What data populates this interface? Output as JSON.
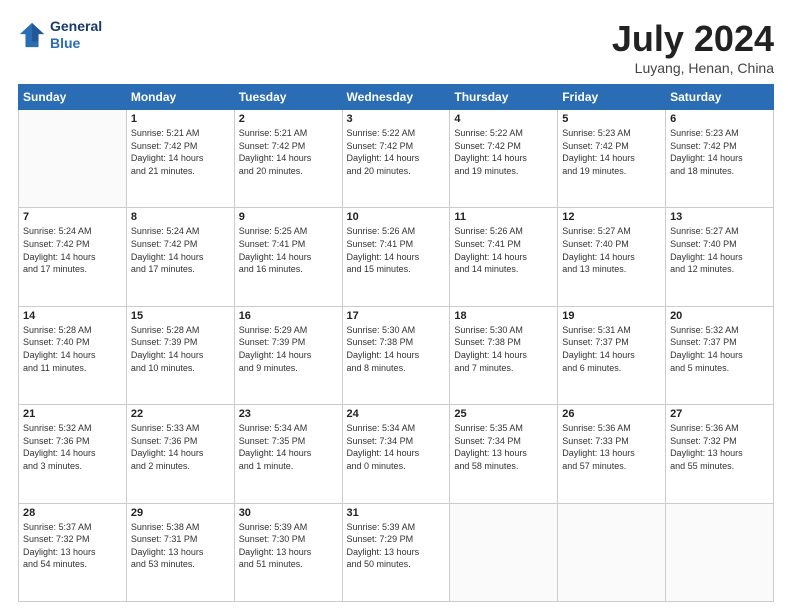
{
  "logo": {
    "line1": "General",
    "line2": "Blue"
  },
  "title": "July 2024",
  "subtitle": "Luyang, Henan, China",
  "weekdays": [
    "Sunday",
    "Monday",
    "Tuesday",
    "Wednesday",
    "Thursday",
    "Friday",
    "Saturday"
  ],
  "weeks": [
    [
      {
        "day": "",
        "info": ""
      },
      {
        "day": "1",
        "info": "Sunrise: 5:21 AM\nSunset: 7:42 PM\nDaylight: 14 hours\nand 21 minutes."
      },
      {
        "day": "2",
        "info": "Sunrise: 5:21 AM\nSunset: 7:42 PM\nDaylight: 14 hours\nand 20 minutes."
      },
      {
        "day": "3",
        "info": "Sunrise: 5:22 AM\nSunset: 7:42 PM\nDaylight: 14 hours\nand 20 minutes."
      },
      {
        "day": "4",
        "info": "Sunrise: 5:22 AM\nSunset: 7:42 PM\nDaylight: 14 hours\nand 19 minutes."
      },
      {
        "day": "5",
        "info": "Sunrise: 5:23 AM\nSunset: 7:42 PM\nDaylight: 14 hours\nand 19 minutes."
      },
      {
        "day": "6",
        "info": "Sunrise: 5:23 AM\nSunset: 7:42 PM\nDaylight: 14 hours\nand 18 minutes."
      }
    ],
    [
      {
        "day": "7",
        "info": "Sunrise: 5:24 AM\nSunset: 7:42 PM\nDaylight: 14 hours\nand 17 minutes."
      },
      {
        "day": "8",
        "info": "Sunrise: 5:24 AM\nSunset: 7:42 PM\nDaylight: 14 hours\nand 17 minutes."
      },
      {
        "day": "9",
        "info": "Sunrise: 5:25 AM\nSunset: 7:41 PM\nDaylight: 14 hours\nand 16 minutes."
      },
      {
        "day": "10",
        "info": "Sunrise: 5:26 AM\nSunset: 7:41 PM\nDaylight: 14 hours\nand 15 minutes."
      },
      {
        "day": "11",
        "info": "Sunrise: 5:26 AM\nSunset: 7:41 PM\nDaylight: 14 hours\nand 14 minutes."
      },
      {
        "day": "12",
        "info": "Sunrise: 5:27 AM\nSunset: 7:40 PM\nDaylight: 14 hours\nand 13 minutes."
      },
      {
        "day": "13",
        "info": "Sunrise: 5:27 AM\nSunset: 7:40 PM\nDaylight: 14 hours\nand 12 minutes."
      }
    ],
    [
      {
        "day": "14",
        "info": "Sunrise: 5:28 AM\nSunset: 7:40 PM\nDaylight: 14 hours\nand 11 minutes."
      },
      {
        "day": "15",
        "info": "Sunrise: 5:28 AM\nSunset: 7:39 PM\nDaylight: 14 hours\nand 10 minutes."
      },
      {
        "day": "16",
        "info": "Sunrise: 5:29 AM\nSunset: 7:39 PM\nDaylight: 14 hours\nand 9 minutes."
      },
      {
        "day": "17",
        "info": "Sunrise: 5:30 AM\nSunset: 7:38 PM\nDaylight: 14 hours\nand 8 minutes."
      },
      {
        "day": "18",
        "info": "Sunrise: 5:30 AM\nSunset: 7:38 PM\nDaylight: 14 hours\nand 7 minutes."
      },
      {
        "day": "19",
        "info": "Sunrise: 5:31 AM\nSunset: 7:37 PM\nDaylight: 14 hours\nand 6 minutes."
      },
      {
        "day": "20",
        "info": "Sunrise: 5:32 AM\nSunset: 7:37 PM\nDaylight: 14 hours\nand 5 minutes."
      }
    ],
    [
      {
        "day": "21",
        "info": "Sunrise: 5:32 AM\nSunset: 7:36 PM\nDaylight: 14 hours\nand 3 minutes."
      },
      {
        "day": "22",
        "info": "Sunrise: 5:33 AM\nSunset: 7:36 PM\nDaylight: 14 hours\nand 2 minutes."
      },
      {
        "day": "23",
        "info": "Sunrise: 5:34 AM\nSunset: 7:35 PM\nDaylight: 14 hours\nand 1 minute."
      },
      {
        "day": "24",
        "info": "Sunrise: 5:34 AM\nSunset: 7:34 PM\nDaylight: 14 hours\nand 0 minutes."
      },
      {
        "day": "25",
        "info": "Sunrise: 5:35 AM\nSunset: 7:34 PM\nDaylight: 13 hours\nand 58 minutes."
      },
      {
        "day": "26",
        "info": "Sunrise: 5:36 AM\nSunset: 7:33 PM\nDaylight: 13 hours\nand 57 minutes."
      },
      {
        "day": "27",
        "info": "Sunrise: 5:36 AM\nSunset: 7:32 PM\nDaylight: 13 hours\nand 55 minutes."
      }
    ],
    [
      {
        "day": "28",
        "info": "Sunrise: 5:37 AM\nSunset: 7:32 PM\nDaylight: 13 hours\nand 54 minutes."
      },
      {
        "day": "29",
        "info": "Sunrise: 5:38 AM\nSunset: 7:31 PM\nDaylight: 13 hours\nand 53 minutes."
      },
      {
        "day": "30",
        "info": "Sunrise: 5:39 AM\nSunset: 7:30 PM\nDaylight: 13 hours\nand 51 minutes."
      },
      {
        "day": "31",
        "info": "Sunrise: 5:39 AM\nSunset: 7:29 PM\nDaylight: 13 hours\nand 50 minutes."
      },
      {
        "day": "",
        "info": ""
      },
      {
        "day": "",
        "info": ""
      },
      {
        "day": "",
        "info": ""
      }
    ]
  ]
}
